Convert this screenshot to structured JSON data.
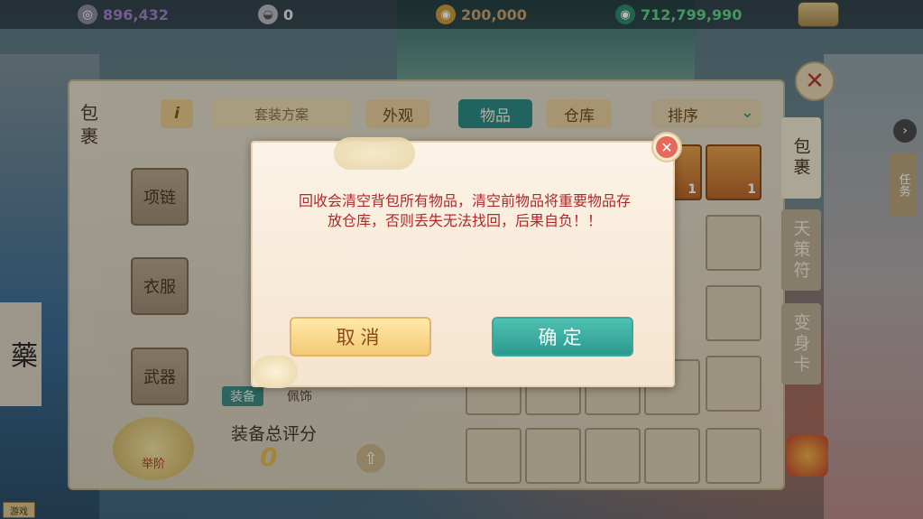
{
  "topbar": {
    "resources": [
      {
        "icon": "silver-coin-icon",
        "value": "896,432",
        "color": "#a080c8"
      },
      {
        "icon": "silver-ingot-icon",
        "value": "0",
        "color": "#e8e8e8"
      },
      {
        "icon": "gold-coin-icon",
        "value": "200,000",
        "color": "#c8a070"
      },
      {
        "icon": "jade-coin-icon",
        "value": "712,799,990",
        "color": "#5fd08a"
      }
    ]
  },
  "bag": {
    "left_title": "包裹",
    "info_label": "i",
    "tabs": {
      "plan": "套装方案",
      "look": "外观",
      "items": "物品",
      "store": "仓库",
      "sort": "排序"
    },
    "equip_slots": [
      "项链",
      "衣服",
      "武器"
    ],
    "equip_toggle": {
      "on": "装备",
      "off": "佩饰"
    },
    "score_label": "装备总评分",
    "score_value": "0",
    "rank_label": "举阶",
    "item_counts": [
      "1",
      "1"
    ],
    "side_tabs": [
      "包裹",
      "天策符",
      "变身卡"
    ]
  },
  "right_hud": {
    "task_label": "任务"
  },
  "scene": {
    "medicine_sign": "藥",
    "bottom_badge": "游戏"
  },
  "dialog": {
    "message": "回收会清空背包所有物品，清空前物品将重要物品存放仓库，否则丢失无法找回，后果自负！！",
    "cancel_label": "取消",
    "confirm_label": "确定",
    "close_symbol": "✕"
  }
}
